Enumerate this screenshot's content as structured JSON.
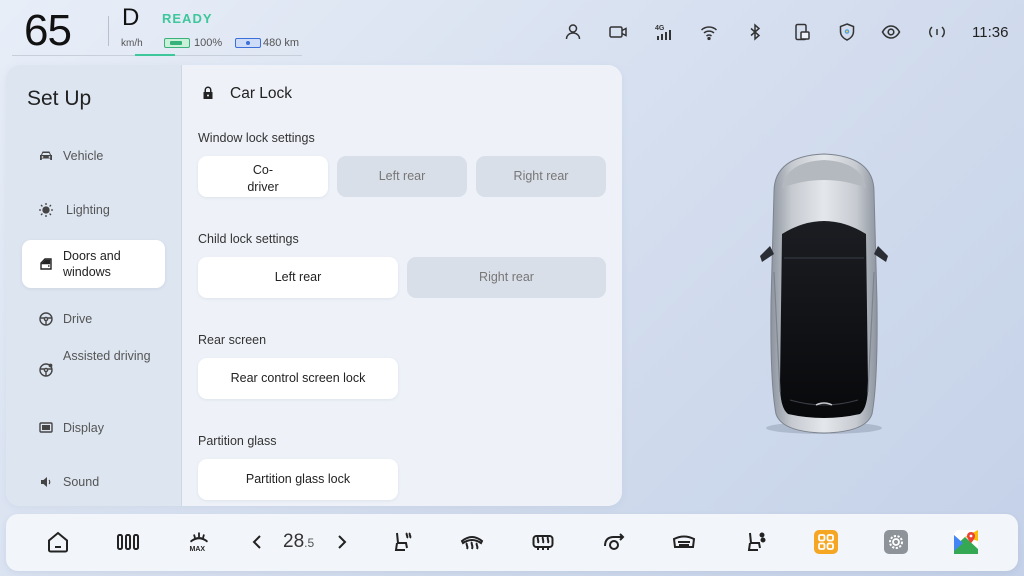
{
  "status_bar": {
    "speed": "65",
    "speed_unit": "km/h",
    "gear": "D",
    "ready_label": "READY",
    "battery_percent": "100%",
    "range": "480 km",
    "time": "11:36",
    "icons": [
      "profile-icon",
      "dashcam-icon",
      "signal-4g-icon",
      "wifi-icon",
      "bluetooth-icon",
      "phone-card-icon",
      "security-shield-icon",
      "eye-icon",
      "broadcast-icon"
    ],
    "colors": {
      "ready": "#3dc79a",
      "battery": "#35b27a",
      "range": "#3c6fd8"
    }
  },
  "sidebar": {
    "title": "Set Up",
    "items": [
      {
        "label": "Vehicle",
        "icon": "car-icon",
        "active": false
      },
      {
        "label": "Lighting",
        "icon": "light-icon",
        "active": false
      },
      {
        "label": "Doors and windows",
        "icon": "door-icon",
        "active": true
      },
      {
        "label": "Drive",
        "icon": "steering-wheel-icon",
        "active": false
      },
      {
        "label": "Assisted driving",
        "icon": "assisted-driving-icon",
        "active": false
      },
      {
        "label": "Display",
        "icon": "display-icon",
        "active": false
      },
      {
        "label": "Sound",
        "icon": "speaker-icon",
        "active": false
      }
    ]
  },
  "content": {
    "section_title": "Car Lock",
    "window_lock": {
      "label": "Window lock settings",
      "options": [
        {
          "label": "Co-\ndriver",
          "selected": true
        },
        {
          "label": "Left rear",
          "selected": false
        },
        {
          "label": "Right rear",
          "selected": false
        }
      ]
    },
    "child_lock": {
      "label": "Child lock settings",
      "options": [
        {
          "label": "Left rear",
          "selected": true
        },
        {
          "label": "Right rear",
          "selected": false
        }
      ]
    },
    "rear_screen": {
      "label": "Rear screen",
      "button": "Rear control screen lock"
    },
    "partition_glass": {
      "label": "Partition glass",
      "button": "Partition glass lock"
    }
  },
  "dock": {
    "temperature_whole": "28",
    "temperature_decimal": ".5",
    "items": [
      "home-icon",
      "split-screen-icon",
      "max-defrost-icon",
      "temp-decrease-icon",
      "temp-increase-icon",
      "seat-heat-icon",
      "front-defrost-icon",
      "rear-defrost-icon",
      "air-recirculation-icon",
      "seat-ventilation-icon",
      "massage-seat-icon",
      "apps-icon",
      "settings-icon",
      "maps-icon"
    ],
    "colors": {
      "apps": "#f5a623",
      "settings": "#8e9299"
    }
  }
}
